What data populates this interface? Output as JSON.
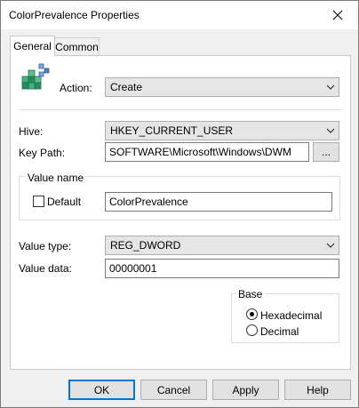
{
  "window": {
    "title": "ColorPrevalence Properties"
  },
  "tabs": [
    {
      "label": "General"
    },
    {
      "label": "Common"
    }
  ],
  "general": {
    "action": {
      "label": "Action:",
      "value": "Create"
    },
    "hive": {
      "label": "Hive:",
      "value": "HKEY_CURRENT_USER"
    },
    "key_path": {
      "label": "Key Path:",
      "value": "SOFTWARE\\Microsoft\\Windows\\DWM",
      "browse_label": "..."
    },
    "value_name": {
      "group_label": "Value name",
      "default_label": "Default",
      "default_checked": false,
      "value": "ColorPrevalence"
    },
    "value_type": {
      "label": "Value type:",
      "value": "REG_DWORD"
    },
    "value_data": {
      "label": "Value data:",
      "value": "00000001"
    },
    "base": {
      "group_label": "Base",
      "options": [
        {
          "label": "Hexadecimal",
          "selected": true
        },
        {
          "label": "Decimal",
          "selected": false
        }
      ]
    }
  },
  "buttons": {
    "ok": "OK",
    "cancel": "Cancel",
    "apply": "Apply",
    "help": "Help"
  },
  "icons": {
    "close": "close-icon",
    "registry": "registry-cubes-icon",
    "dropdown": "chevron-down-icon"
  }
}
